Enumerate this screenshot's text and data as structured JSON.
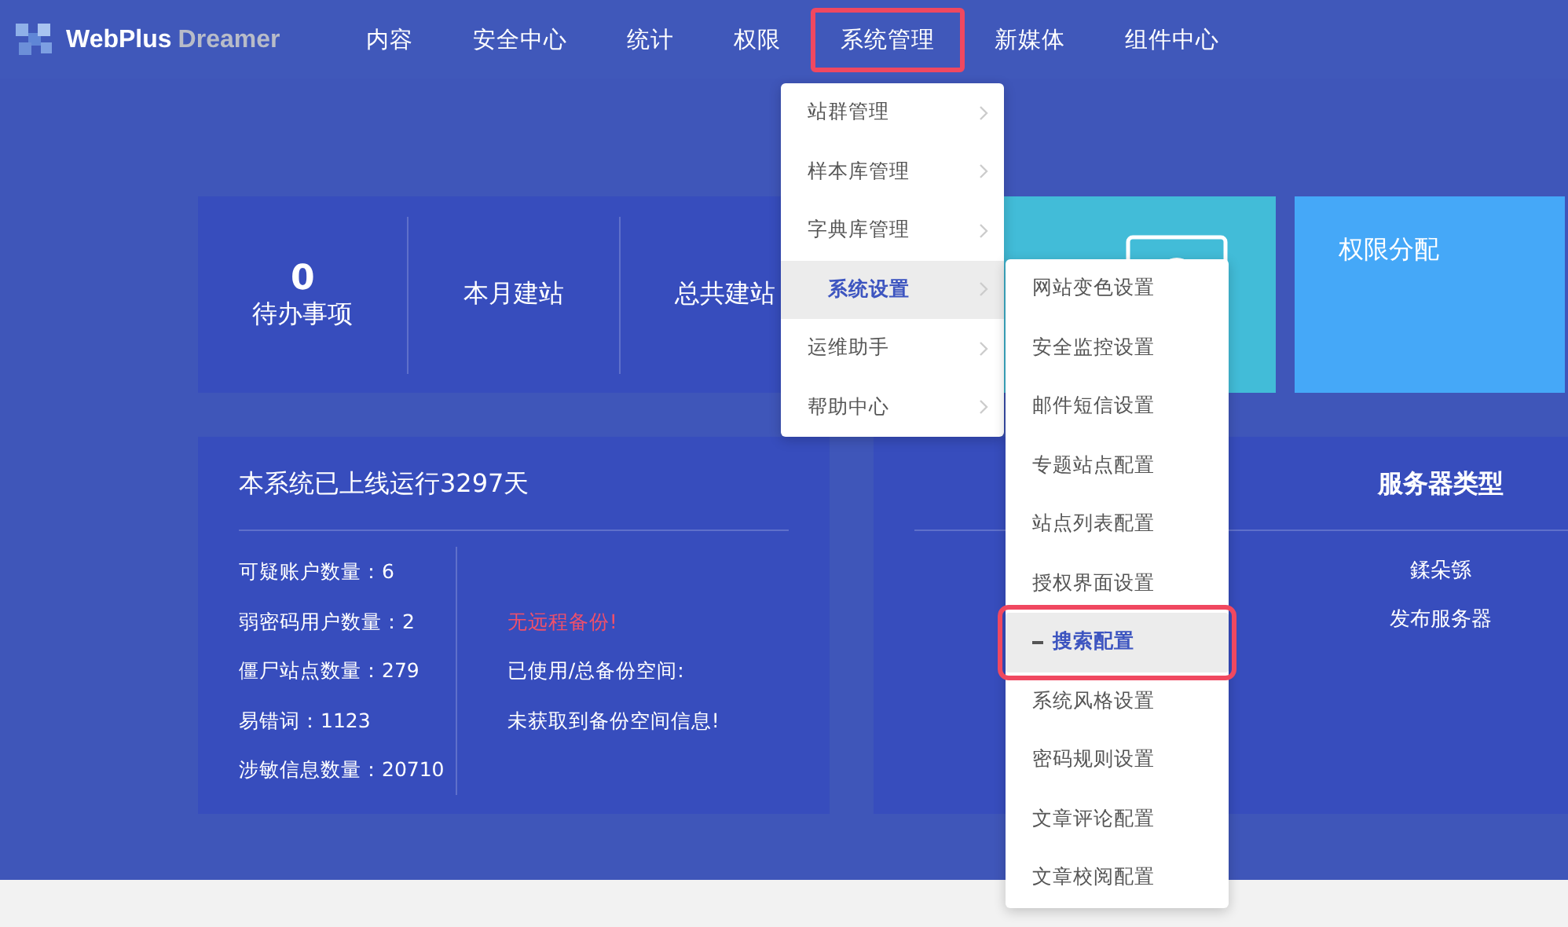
{
  "logo": {
    "brand": "WebPlus",
    "product": "Dreamer"
  },
  "nav": [
    {
      "label": "内容",
      "highlighted": false
    },
    {
      "label": "安全中心",
      "highlighted": false
    },
    {
      "label": "统计",
      "highlighted": false
    },
    {
      "label": "权限",
      "highlighted": false
    },
    {
      "label": "系统管理",
      "highlighted": true
    },
    {
      "label": "新媒体",
      "highlighted": false
    },
    {
      "label": "组件中心",
      "highlighted": false
    }
  ],
  "stats_card": {
    "sections": [
      {
        "value": "0",
        "label": "待办事项"
      },
      {
        "label": "本月建站"
      },
      {
        "label": "总共建站"
      }
    ]
  },
  "tile_blue": {
    "title": "权限分配"
  },
  "system_card": {
    "title": "本系统已上线运行3297天",
    "left": [
      "可疑账户数量：6",
      "弱密码用户数量：2",
      "僵尸站点数量：279",
      "易错词：1123",
      "涉敏信息数量：20710"
    ],
    "right": [
      {
        "text": "无远程备份!",
        "alert": true
      },
      {
        "text": "已使用/总备份空间:",
        "alert": false
      },
      {
        "text": "未获取到备份空间信息!",
        "alert": false
      }
    ]
  },
  "server_card": {
    "title": "服务器类型",
    "items": [
      "鍒朵綔",
      "发布服务器"
    ]
  },
  "menu": [
    {
      "label": "站群管理",
      "selected": false
    },
    {
      "label": "样本库管理",
      "selected": false
    },
    {
      "label": "字典库管理",
      "selected": false
    },
    {
      "label": "系统设置",
      "selected": true
    },
    {
      "label": "运维助手",
      "selected": false
    },
    {
      "label": "帮助中心",
      "selected": false
    }
  ],
  "submenu": [
    {
      "label": "网站变色设置",
      "selected": false,
      "highlighted": false
    },
    {
      "label": "安全监控设置",
      "selected": false,
      "highlighted": false
    },
    {
      "label": "邮件短信设置",
      "selected": false,
      "highlighted": false
    },
    {
      "label": "专题站点配置",
      "selected": false,
      "highlighted": false
    },
    {
      "label": "站点列表配置",
      "selected": false,
      "highlighted": false
    },
    {
      "label": "授权界面设置",
      "selected": false,
      "highlighted": false
    },
    {
      "label": "搜索配置",
      "selected": true,
      "highlighted": true
    },
    {
      "label": "系统风格设置",
      "selected": false,
      "highlighted": false
    },
    {
      "label": "密码规则设置",
      "selected": false,
      "highlighted": false
    },
    {
      "label": "文章评论配置",
      "selected": false,
      "highlighted": false
    },
    {
      "label": "文章校阅配置",
      "selected": false,
      "highlighted": false
    }
  ]
}
